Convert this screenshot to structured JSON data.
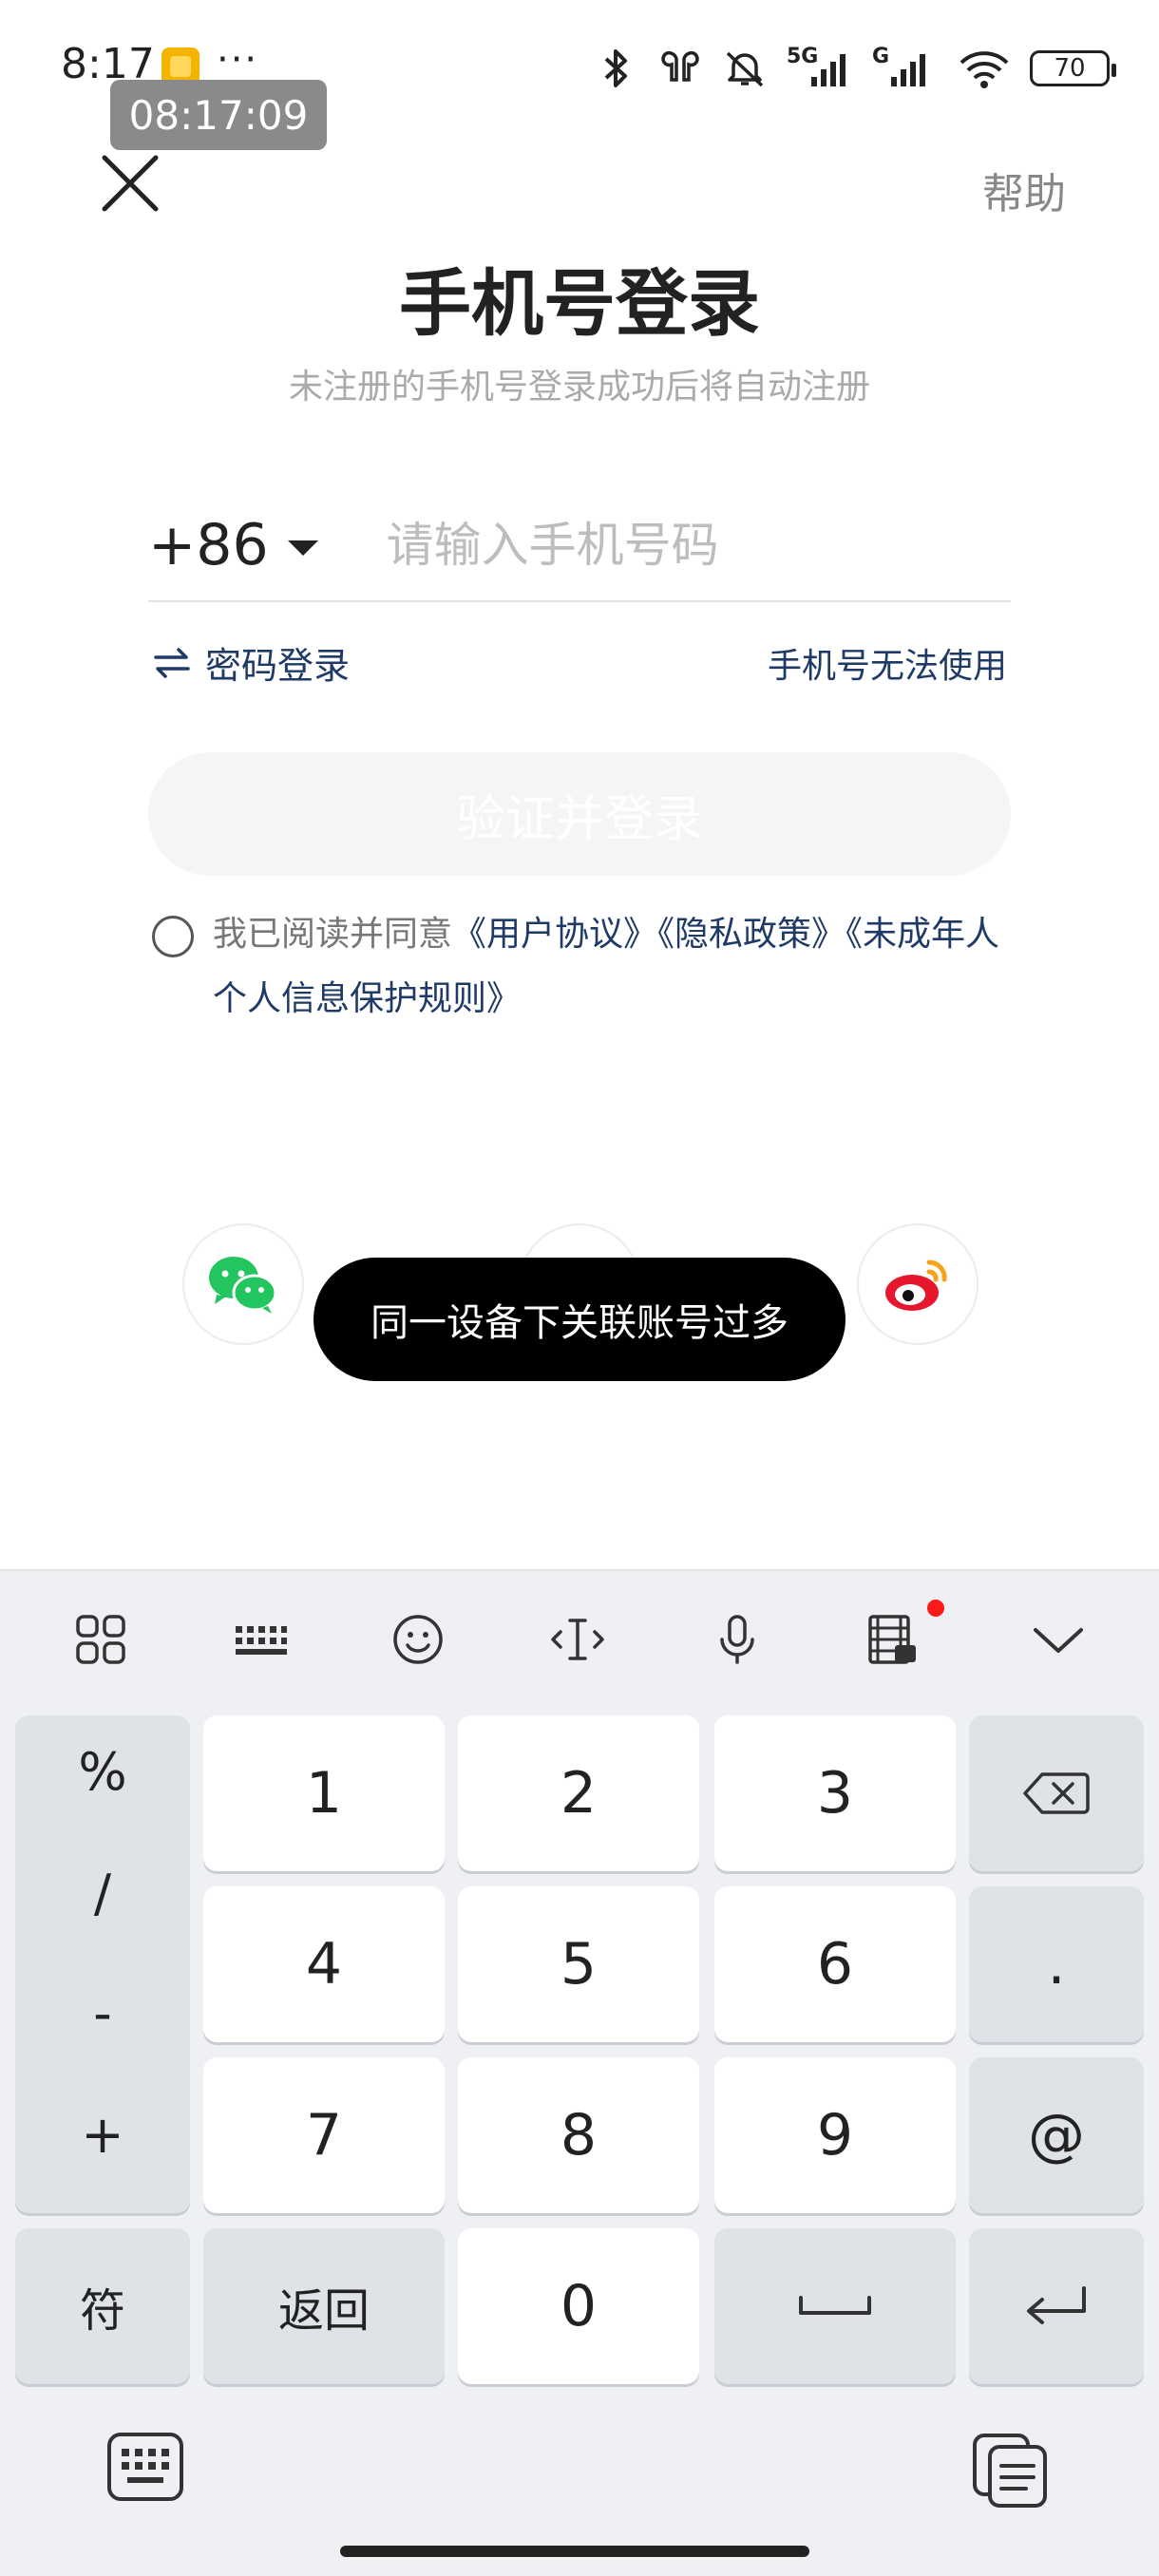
{
  "status_bar": {
    "time": "8:17",
    "more": "···",
    "screen_record_time": "08:17:09",
    "network_1": "5G",
    "network_2": "G",
    "battery": "70",
    "icons": [
      "app-notification-icon",
      "bluetooth-icon",
      "earbuds-icon",
      "mute-icon",
      "signal-icon",
      "signal-icon",
      "wifi-icon",
      "battery-icon"
    ]
  },
  "header": {
    "help": "帮助",
    "title": "手机号登录",
    "subtitle": "未注册的手机号登录成功后将自动注册"
  },
  "phone": {
    "country_code": "+86",
    "placeholder": "请输入手机号码"
  },
  "links": {
    "password_login": "密码登录",
    "cannot_use_phone": "手机号无法使用"
  },
  "verify_button": "验证并登录",
  "agreement": {
    "prefix": "我已阅读并同意",
    "user_agreement": "《用户协议》",
    "privacy_policy": "《隐私政策》",
    "minor_rules": "《未成年人个人信息保护规则》"
  },
  "toast": "同一设备下关联账号过多",
  "keyboard": {
    "symbols": [
      "%",
      "/",
      "-",
      "+"
    ],
    "digits": [
      "1",
      "2",
      "3",
      "4",
      "5",
      "6",
      "7",
      "8",
      "9",
      "0"
    ],
    "dot": ".",
    "at": "@",
    "fu": "符",
    "back": "返回"
  },
  "colors": {
    "link": "#1f3a66",
    "wechat": "#23c55e",
    "weibo": "#e6162d",
    "toast_bg": "#000000"
  }
}
